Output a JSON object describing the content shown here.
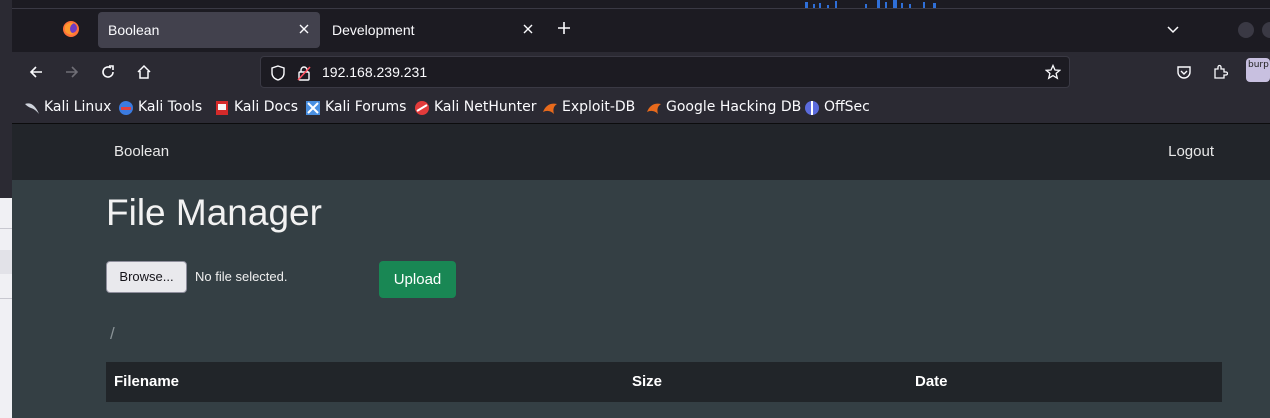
{
  "tabs": [
    {
      "label": "Boolean",
      "active": true
    },
    {
      "label": "Development",
      "active": false
    }
  ],
  "address_bar": {
    "url": "192.168.239.231"
  },
  "bookmarks": [
    {
      "label": "Kali Linux",
      "icon": "kali-dragon-icon"
    },
    {
      "label": "Kali Tools",
      "icon": "kali-tools-icon"
    },
    {
      "label": "Kali Docs",
      "icon": "kali-docs-icon"
    },
    {
      "label": "Kali Forums",
      "icon": "kali-forums-icon"
    },
    {
      "label": "Kali NetHunter",
      "icon": "kali-nethunter-icon"
    },
    {
      "label": "Exploit-DB",
      "icon": "exploit-db-icon"
    },
    {
      "label": "Google Hacking DB",
      "icon": "ghdb-icon"
    },
    {
      "label": "OffSec",
      "icon": "offsec-icon"
    }
  ],
  "extension": {
    "label": "burp"
  },
  "app": {
    "brand": "Boolean",
    "logout": "Logout",
    "title": "File Manager",
    "browse_label": "Browse...",
    "file_status": "No file selected.",
    "upload_label": "Upload",
    "path": "/",
    "table_headers": [
      "Filename",
      "Size",
      "Date"
    ]
  },
  "colors": {
    "upload_green": "#198754",
    "page_bg": "#343f44",
    "navbar_bg": "#22252a"
  }
}
